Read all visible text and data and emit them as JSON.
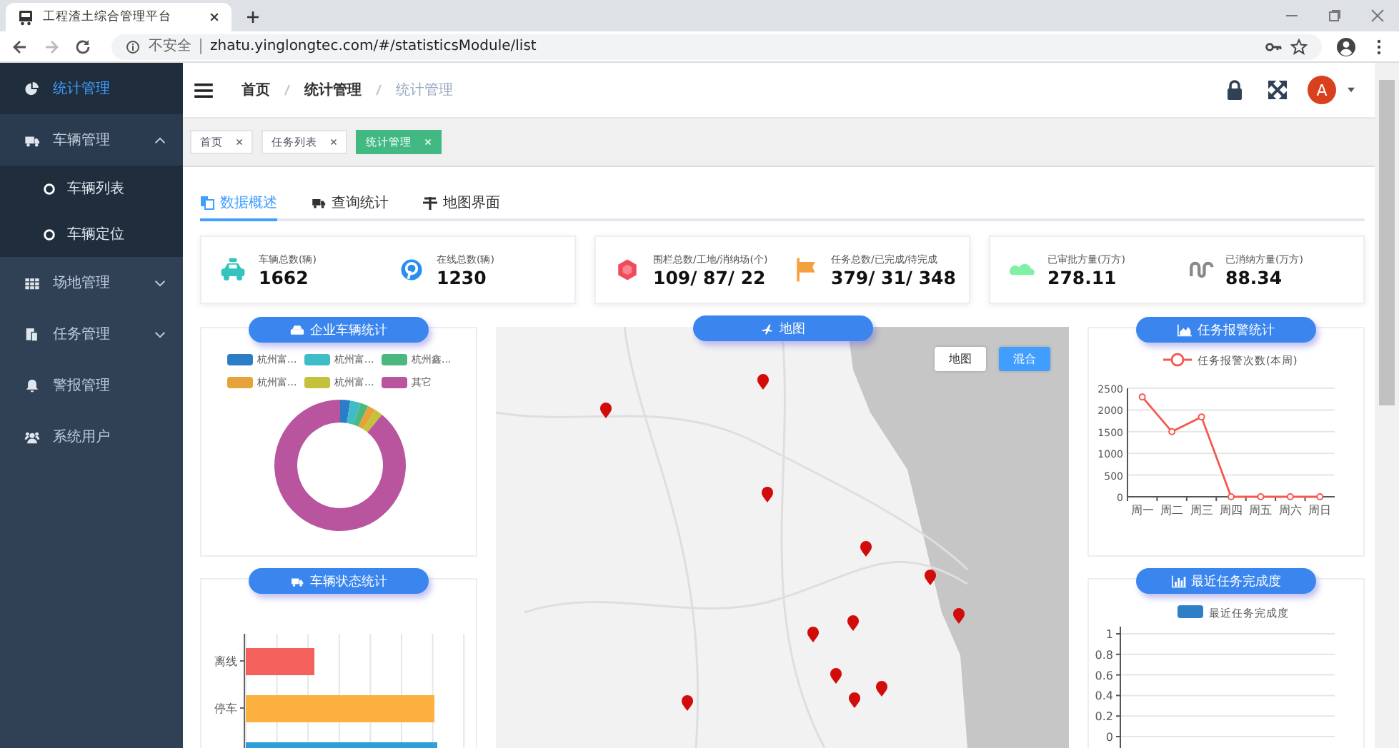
{
  "browser": {
    "tab_title": "工程渣土综合管理平台",
    "security": "不安全",
    "url": "zhatu.yinglongtec.com/#/statisticsModule/list"
  },
  "sidebar": {
    "items": [
      {
        "label": "统计管理",
        "selected": true
      },
      {
        "label": "车辆管理",
        "selected": false,
        "expanded": true,
        "children": [
          {
            "label": "车辆列表",
            "selected": false
          },
          {
            "label": "车辆定位",
            "selected": false
          }
        ]
      },
      {
        "label": "场地管理",
        "selected": false,
        "expanded": false
      },
      {
        "label": "任务管理",
        "selected": false,
        "expanded": false
      },
      {
        "label": "警报管理",
        "selected": false
      },
      {
        "label": "系统用户",
        "selected": false
      }
    ]
  },
  "breadcrumb": [
    "首页",
    "统计管理",
    "统计管理"
  ],
  "avatar": {
    "initial": "A"
  },
  "tags": [
    {
      "label": "首页",
      "selected": false
    },
    {
      "label": "任务列表",
      "selected": false
    },
    {
      "label": "统计管理",
      "selected": true
    }
  ],
  "tabs": [
    {
      "label": "数据概述",
      "selected": true
    },
    {
      "label": "查询统计",
      "selected": false
    },
    {
      "label": "地图界面",
      "selected": false
    }
  ],
  "stat_cards": [
    {
      "stats": [
        {
          "label": "车辆总数(辆)",
          "value": "1662"
        },
        {
          "label": "在线总数(辆)",
          "value": "1230"
        }
      ]
    },
    {
      "stats": [
        {
          "label": "围栏总数/工地/消纳场(个)",
          "value": "109/ 87/ 22"
        },
        {
          "label": "任务总数/已完成/待完成",
          "value": "379/ 31/ 348"
        }
      ]
    },
    {
      "stats": [
        {
          "label": "已审批方量(万方)",
          "value": "278.11"
        },
        {
          "label": "已消纳方量(万方)",
          "value": "88.34"
        }
      ]
    }
  ],
  "vehicle_companies": {
    "title": "企业车辆统计",
    "legend": [
      {
        "label": "杭州富...",
        "color": "#2b7dc8"
      },
      {
        "label": "杭州富...",
        "color": "#3ebdc9"
      },
      {
        "label": "杭州鑫...",
        "color": "#4cb87f"
      },
      {
        "label": "杭州富...",
        "color": "#e8a23a"
      },
      {
        "label": "杭州富...",
        "color": "#c4c23c"
      },
      {
        "label": "其它",
        "color": "#b9559e"
      }
    ]
  },
  "vehicle_status": {
    "title": "车辆状态统计",
    "categories": [
      {
        "label": "离线",
        "color": "#f4615c"
      },
      {
        "label": "停车",
        "color": "#fbb040"
      },
      {
        "color": "#2d9fd9"
      }
    ]
  },
  "map": {
    "title": "地图",
    "map_types": [
      {
        "label": "地图",
        "selected": false
      },
      {
        "label": "混合",
        "selected": true
      }
    ]
  },
  "alarm_stats": {
    "title": "任务报警统计",
    "chart_data": {
      "type": "line",
      "categories": [
        "周一",
        "周二",
        "周三",
        "周四",
        "周五",
        "周六",
        "周日"
      ],
      "series": [
        {
          "name": "任务报警次数(本周)",
          "color": "#f4584f",
          "marker": true,
          "values": [
            2300,
            1500,
            1840,
            0,
            0,
            0,
            0
          ]
        }
      ],
      "ylim": [
        0,
        2500
      ],
      "yticks": [
        0,
        500,
        1000,
        1500,
        2000,
        2500
      ],
      "grid": true
    }
  },
  "task_completion": {
    "title": "最近任务完成度",
    "chart_data": {
      "type": "bar",
      "ylim": [
        0,
        1
      ],
      "yticks": [
        0,
        0.2,
        0.4,
        0.6,
        0.8,
        1
      ],
      "grid": true,
      "series": [
        {
          "name": "最近任务完成度",
          "color": "#2f7ec6"
        }
      ]
    }
  }
}
